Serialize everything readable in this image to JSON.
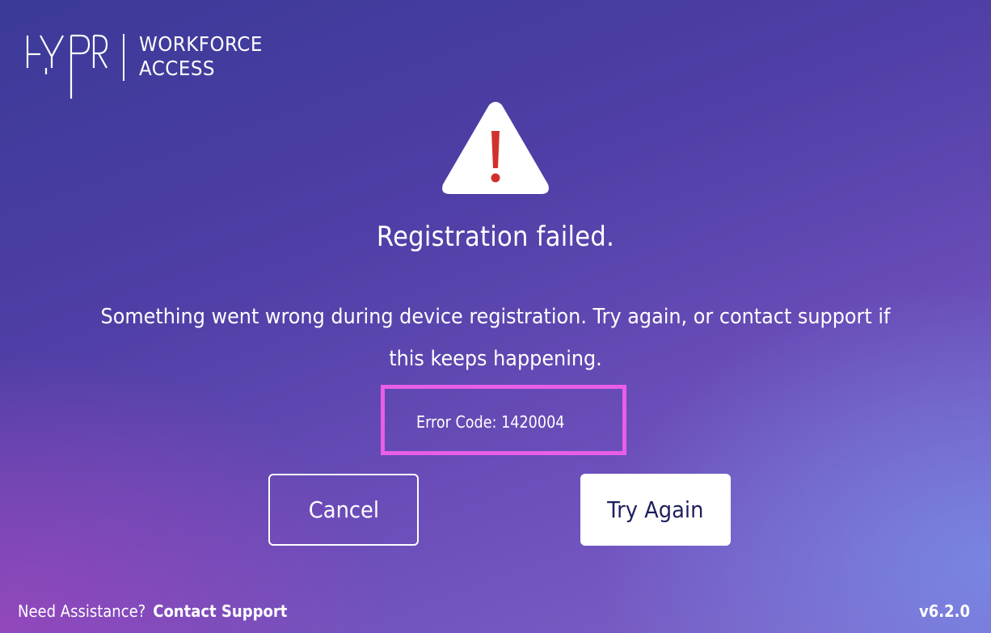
{
  "brand": {
    "logo_name": "HYPR",
    "product_line1": "WORKFORCE",
    "product_line2": "ACCESS"
  },
  "dialog": {
    "icon": "warning-triangle-icon",
    "title": "Registration failed.",
    "message": "Something went wrong during device registration. Try again, or contact support if this keeps happening.",
    "error_code": "Error Code: 1420004"
  },
  "buttons": {
    "cancel_label": "Cancel",
    "try_again_label": "Try Again"
  },
  "footer": {
    "assistance_text": "Need Assistance?",
    "contact_link": "Contact Support",
    "version": "v6.2.0"
  },
  "colors": {
    "highlight_border": "#e85fe6",
    "button_text_dark": "#1d1f5e",
    "warning_red": "#d0312d"
  }
}
